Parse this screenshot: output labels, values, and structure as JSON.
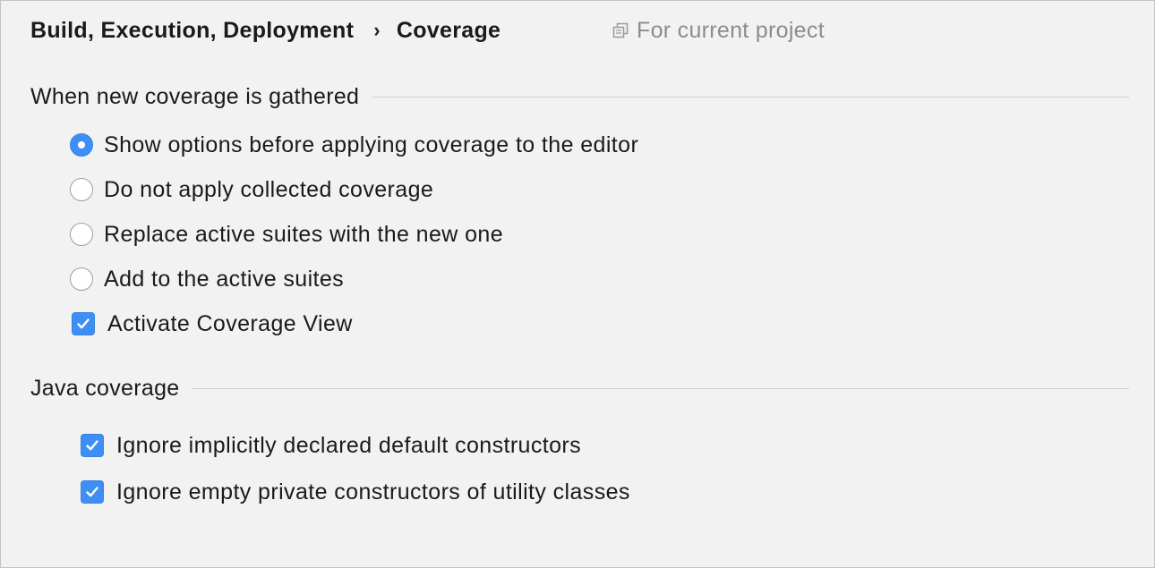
{
  "breadcrumb": {
    "parent": "Build, Execution, Deployment",
    "separator": "›",
    "current": "Coverage"
  },
  "scope": {
    "icon": "project-scope-icon",
    "label": "For current project"
  },
  "sections": {
    "gathered": {
      "title": "When new coverage is gathered",
      "options": [
        {
          "type": "radio",
          "label": "Show options before applying coverage to the editor",
          "checked": true
        },
        {
          "type": "radio",
          "label": "Do not apply collected coverage",
          "checked": false
        },
        {
          "type": "radio",
          "label": "Replace active suites with the new one",
          "checked": false
        },
        {
          "type": "radio",
          "label": "Add to the active suites",
          "checked": false
        },
        {
          "type": "checkbox",
          "label": "Activate Coverage View",
          "checked": true
        }
      ]
    },
    "java": {
      "title": "Java coverage",
      "options": [
        {
          "type": "checkbox",
          "label": "Ignore implicitly declared default constructors",
          "checked": true
        },
        {
          "type": "checkbox",
          "label": "Ignore empty private constructors of utility classes",
          "checked": true
        }
      ]
    }
  },
  "colors": {
    "accent": "#3d8ff5",
    "background": "#f2f2f2",
    "muted_text": "#8c8c8c",
    "separator": "#cfcfcf"
  }
}
